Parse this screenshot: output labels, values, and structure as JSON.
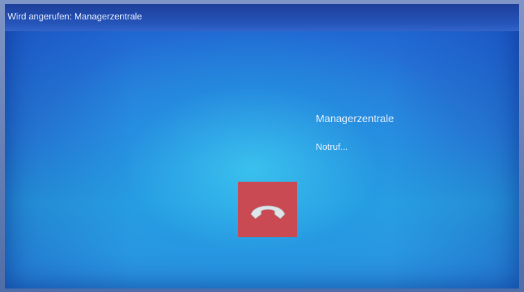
{
  "window": {
    "title": "Wird angerufen: Managerzentrale"
  },
  "call": {
    "caller_name": "Managerzentrale",
    "status": "Notruf...",
    "hangup_icon": "phone-hangup-icon",
    "hangup_color": "#c94a52"
  },
  "colors": {
    "screen_blue": "#2a86de",
    "titlebar_blue": "#1d3f9a"
  }
}
